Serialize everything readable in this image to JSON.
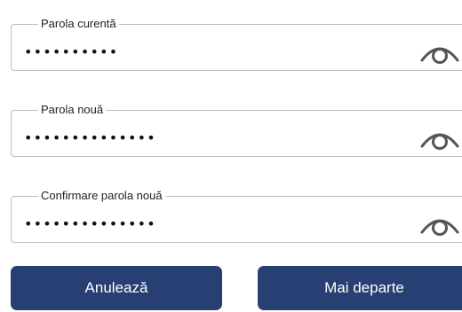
{
  "form": {
    "fields": [
      {
        "label": "Parola curentă",
        "value": "••••••••••"
      },
      {
        "label": "Parola nouă",
        "value": "••••••••••••••"
      },
      {
        "label": "Confirmare parola nouă",
        "value": "••••••••••••••"
      }
    ],
    "toggle_icon": "eye-icon"
  },
  "actions": {
    "cancel_label": "Anulează",
    "next_label": "Mai departe"
  },
  "colors": {
    "button_bg": "#273f72",
    "button_text": "#ffffff",
    "field_border": "#bcbcbc",
    "eye_icon": "#555555"
  }
}
